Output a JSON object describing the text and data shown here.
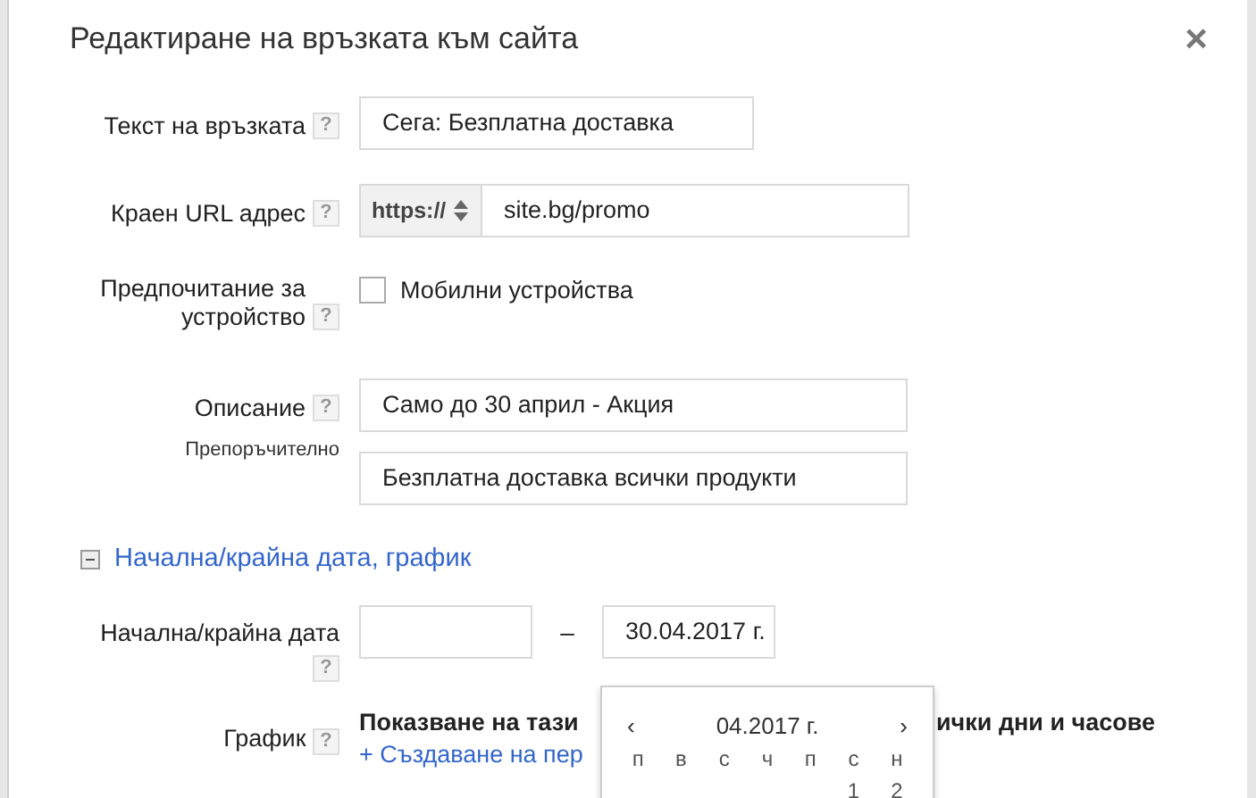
{
  "dialog": {
    "title": "Редактиране на връзката към сайта",
    "close": "×"
  },
  "rows": [
    {
      "kind": "text",
      "label": "Текст на връзката",
      "help": "?",
      "value": "Сега: Безплатна доставка"
    },
    {
      "kind": "url",
      "label": "Краен URL адрес",
      "help": "?",
      "protocol": "https://",
      "value": "site.bg/promo"
    },
    {
      "kind": "checkbox",
      "label": "Предпочитание за устройство",
      "help": "?",
      "option": "Мобилни устройства",
      "checked": false
    },
    {
      "kind": "description",
      "label": "Описание",
      "help": "?",
      "note": "Препоръчително",
      "values": [
        "Само до 30 април - Акция",
        "Безплатна доставка всички продукти"
      ]
    }
  ],
  "section": {
    "label": "Начална/крайна дата, график",
    "expanded": true
  },
  "dates": {
    "label": "Начална/крайна дата",
    "help": "?",
    "separator": "–",
    "end": "30.04.2017 г."
  },
  "schedule": {
    "label": "График",
    "help": "?",
    "text_before": "Показване на тази",
    "text_after": "ички дни и часове",
    "link": "+ Създаване на пер"
  },
  "calendar": {
    "prev": "‹",
    "month": "04.2017 г.",
    "next": "›",
    "weekdays": [
      "п",
      "в",
      "с",
      "ч",
      "п",
      "с",
      "н"
    ],
    "days": [
      "1",
      "2"
    ]
  }
}
